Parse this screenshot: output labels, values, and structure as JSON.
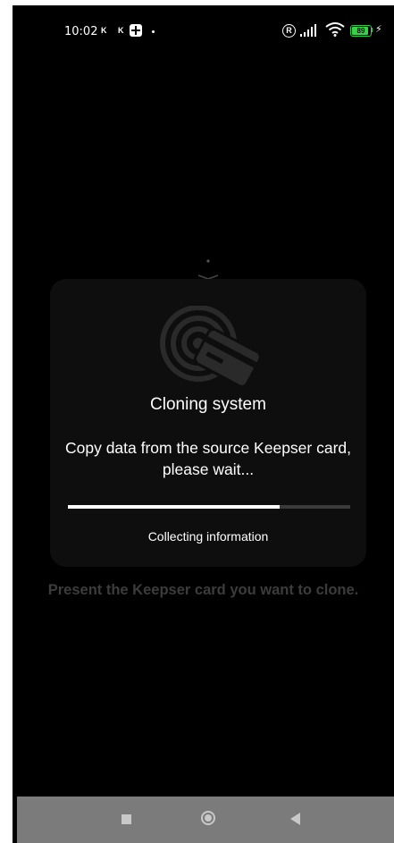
{
  "status_bar": {
    "time": "10:02",
    "notif_1": "K",
    "notif_2": "K",
    "registered_icon": "R",
    "battery_level": "89",
    "battery_fraction": 0.89
  },
  "dialog": {
    "title": "Cloning system",
    "message": "Copy data from the source Keepser card, please wait...",
    "progress": 0.75,
    "status": "Collecting information"
  },
  "instruction": "Present the Keepser card you want to clone.",
  "colors": {
    "background": "#000000",
    "card": "#0e0e0e",
    "progress_fill": "#ffffff",
    "progress_track": "#3a3a3a",
    "nav_bar": "#7b7b7b",
    "battery": "#3ad048"
  },
  "icons": {
    "nfc_card": "nfc-card-icon",
    "chevron": "chevron-up-icon",
    "nav_recent": "square-icon",
    "nav_home": "circle-icon",
    "nav_back": "triangle-back-icon"
  }
}
